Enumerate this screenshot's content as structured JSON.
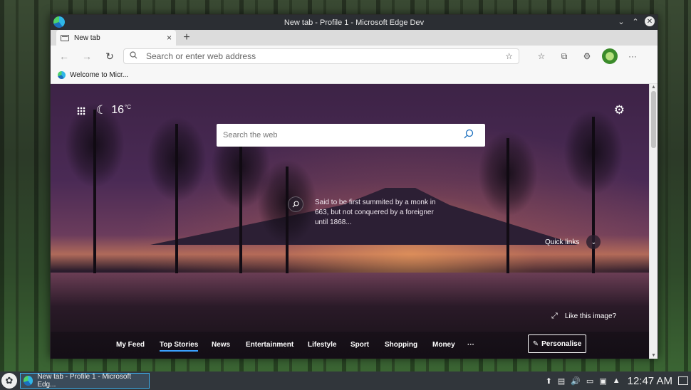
{
  "window": {
    "title": "New tab - Profile 1 - Microsoft Edge Dev",
    "controls": {
      "minimize": "⌄",
      "maximize": "⌃",
      "close": "✕"
    }
  },
  "tab": {
    "label": "New tab",
    "close": "×",
    "new_tab": "+"
  },
  "toolbar": {
    "back": "←",
    "forward": "→",
    "refresh": "↻",
    "address_placeholder": "Search or enter web address",
    "add_favorite": "☆",
    "favorites": "☆",
    "collections": "⧉",
    "extensions": "⚙",
    "more": "···"
  },
  "bookmarks": {
    "item_label": "Welcome to Micr..."
  },
  "ntp": {
    "temperature": "16",
    "temperature_unit": "°C",
    "moon": "☾",
    "settings": "⚙",
    "search_placeholder": "Search the web",
    "fact_text": "Said to be first summited by a monk in 663, but not conquered by a foreigner until 1868...",
    "quick_links": "Quick links",
    "like_image": "Like this image?",
    "feed_tabs": [
      "My Feed",
      "Top Stories",
      "News",
      "Entertainment",
      "Lifestyle",
      "Sport",
      "Shopping",
      "Money",
      "···"
    ],
    "active_feed_tab": "Top Stories",
    "personalise": "Personalise"
  },
  "taskbar": {
    "task_label": "New tab - Profile 1 - Microsoft Edg...",
    "clock": "12:47 AM"
  },
  "colors": {
    "accent": "#3daee9",
    "feed_underline": "#3aa0ff"
  }
}
